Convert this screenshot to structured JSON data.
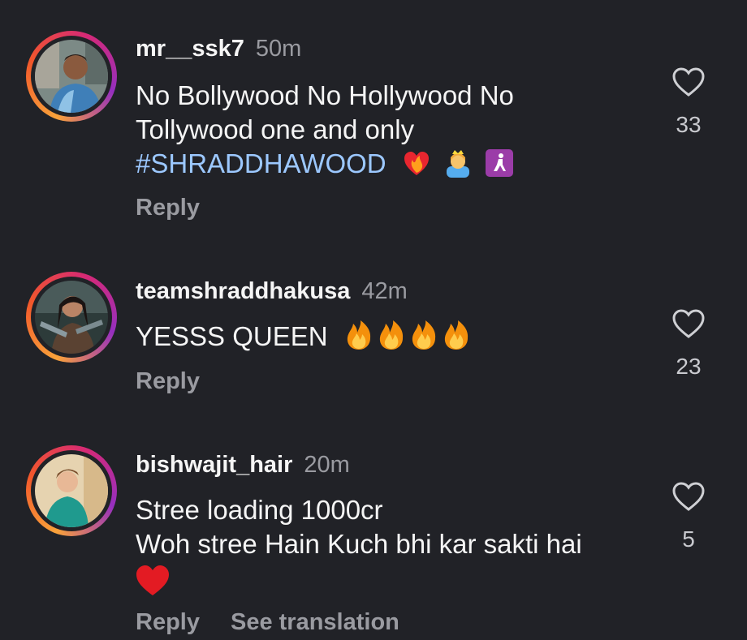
{
  "comments": [
    {
      "username": "mr__ssk7",
      "time": "50m",
      "text_lines": [
        "No Bollywood No Hollywood No",
        "Tollywood one and only"
      ],
      "hashtag": "#SHRADDHAWOOD",
      "emojis": [
        "heart-on-fire",
        "princess",
        "woman-kneeling-sign"
      ],
      "likes": "33",
      "actions": [
        "Reply"
      ]
    },
    {
      "username": "teamshraddhakusa",
      "time": "42m",
      "text_lines": [
        "YESSS QUEEN"
      ],
      "emojis": [
        "fire",
        "fire",
        "fire",
        "fire"
      ],
      "likes": "23",
      "actions": [
        "Reply"
      ]
    },
    {
      "username": "bishwajit_hair",
      "time": "20m",
      "text_lines": [
        "Stree loading 1000cr",
        "Woh stree Hain Kuch bhi kar sakti hai"
      ],
      "emojis": [
        "red-heart"
      ],
      "likes": "5",
      "actions": [
        "Reply",
        "See translation"
      ]
    }
  ],
  "colors": {
    "background": "#212227",
    "hashtag": "#9cc8ff",
    "muted": "#9a9ba1"
  }
}
